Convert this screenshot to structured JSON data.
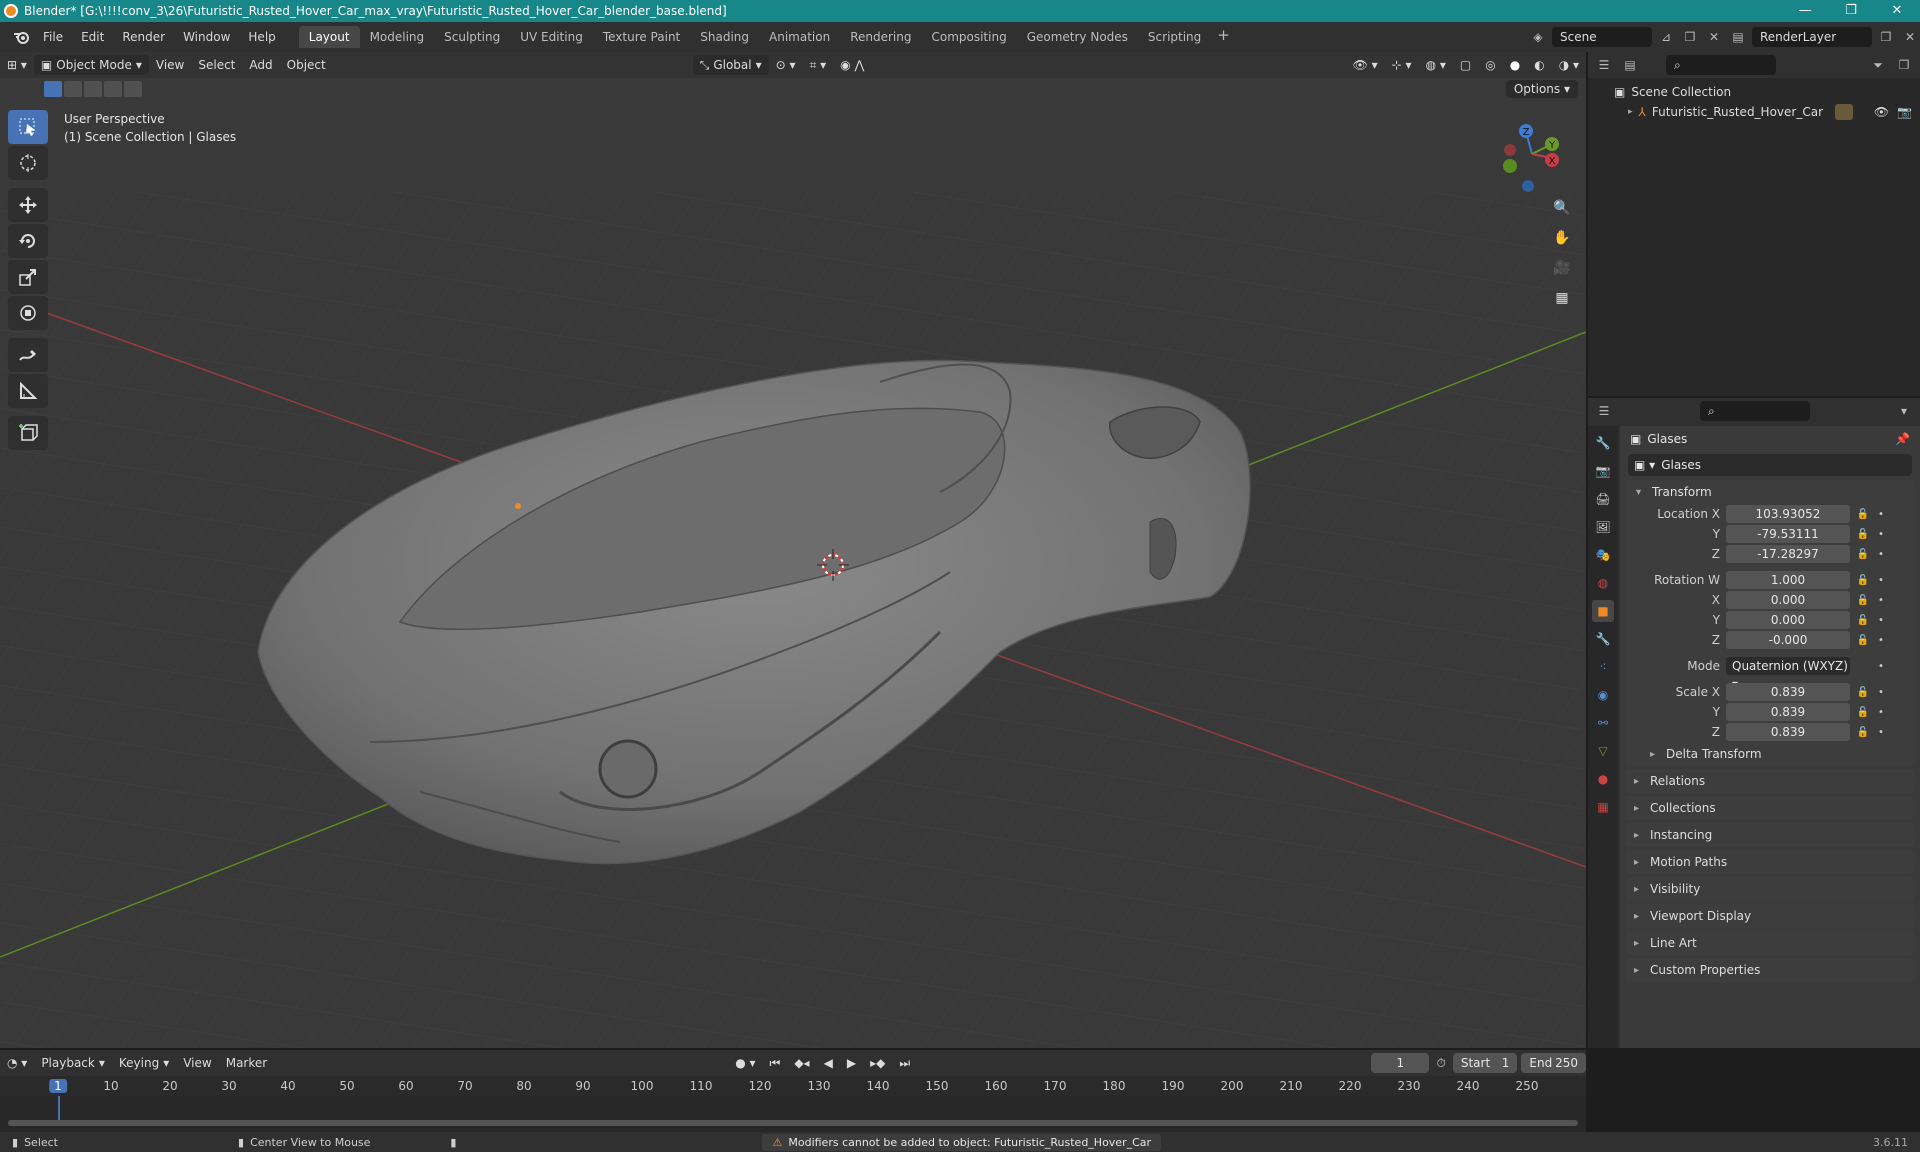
{
  "window": {
    "title": "Blender* [G:\\!!!!conv_3\\26\\Futuristic_Rusted_Hover_Car_max_vray\\Futuristic_Rusted_Hover_Car_blender_base.blend]",
    "minimize": "—",
    "maximize": "❐",
    "close": "✕"
  },
  "menu": [
    "File",
    "Edit",
    "Render",
    "Window",
    "Help"
  ],
  "workspaces": [
    "Layout",
    "Modeling",
    "Sculpting",
    "UV Editing",
    "Texture Paint",
    "Shading",
    "Animation",
    "Rendering",
    "Compositing",
    "Geometry Nodes",
    "Scripting"
  ],
  "workspace_active": "Layout",
  "workspace_add": "+",
  "scene": {
    "name": "Scene",
    "view_layer": "RenderLayer"
  },
  "viewport": {
    "mode": "Object Mode",
    "menus": [
      "View",
      "Select",
      "Add",
      "Object"
    ],
    "orientation": "Global",
    "options_label": "Options",
    "perspective_label": "User Perspective",
    "collection_label": "(1) Scene Collection | Glases",
    "gizmo_axes": {
      "x": "X",
      "y": "Y",
      "z": "Z"
    }
  },
  "outliner": {
    "root": "Scene Collection",
    "items": [
      {
        "label": "Futuristic_Rusted_Hover_Car"
      }
    ]
  },
  "properties": {
    "object_name": "Glases",
    "data_name": "Glases",
    "transform_label": "Transform",
    "location": {
      "label": "Location X",
      "x": "103.93052",
      "y": "-79.53111",
      "z": "-17.28297"
    },
    "rotation": {
      "label": "Rotation W",
      "w": "1.000",
      "x": "0.000",
      "y": "0.000",
      "z": "-0.000"
    },
    "mode": {
      "label": "Mode",
      "value": "Quaternion (WXYZ)"
    },
    "scale": {
      "label": "Scale X",
      "x": "0.839",
      "y": "0.839",
      "z": "0.839"
    },
    "axis_labels": {
      "y": "Y",
      "z": "Z",
      "x": "X"
    },
    "delta_transform": "Delta Transform",
    "panels": [
      "Relations",
      "Collections",
      "Instancing",
      "Motion Paths",
      "Visibility",
      "Viewport Display",
      "Line Art",
      "Custom Properties"
    ]
  },
  "timeline": {
    "menus": [
      "Playback",
      "Keying",
      "View",
      "Marker"
    ],
    "current_frame": "1",
    "start_label": "Start",
    "start": "1",
    "end_label": "End",
    "end": "250",
    "ruler": [
      "10",
      "20",
      "30",
      "40",
      "50",
      "60",
      "70",
      "80",
      "90",
      "100",
      "110",
      "120",
      "130",
      "140",
      "150",
      "160",
      "170",
      "180",
      "190",
      "200",
      "210",
      "220",
      "230",
      "240",
      "250"
    ],
    "playhead": "1"
  },
  "status": {
    "select": "Select",
    "center_view": "Center View to Mouse",
    "warning": "Modifiers cannot be added to object: Futuristic_Rusted_Hover_Car",
    "version": "3.6.11"
  },
  "colors": {
    "titlebar": "#17878a",
    "accent": "#4772b3",
    "x_axis": "#c63d45",
    "y_axis": "#6b9a27",
    "z_axis": "#3b7bd9",
    "origin": "#f08a24"
  }
}
